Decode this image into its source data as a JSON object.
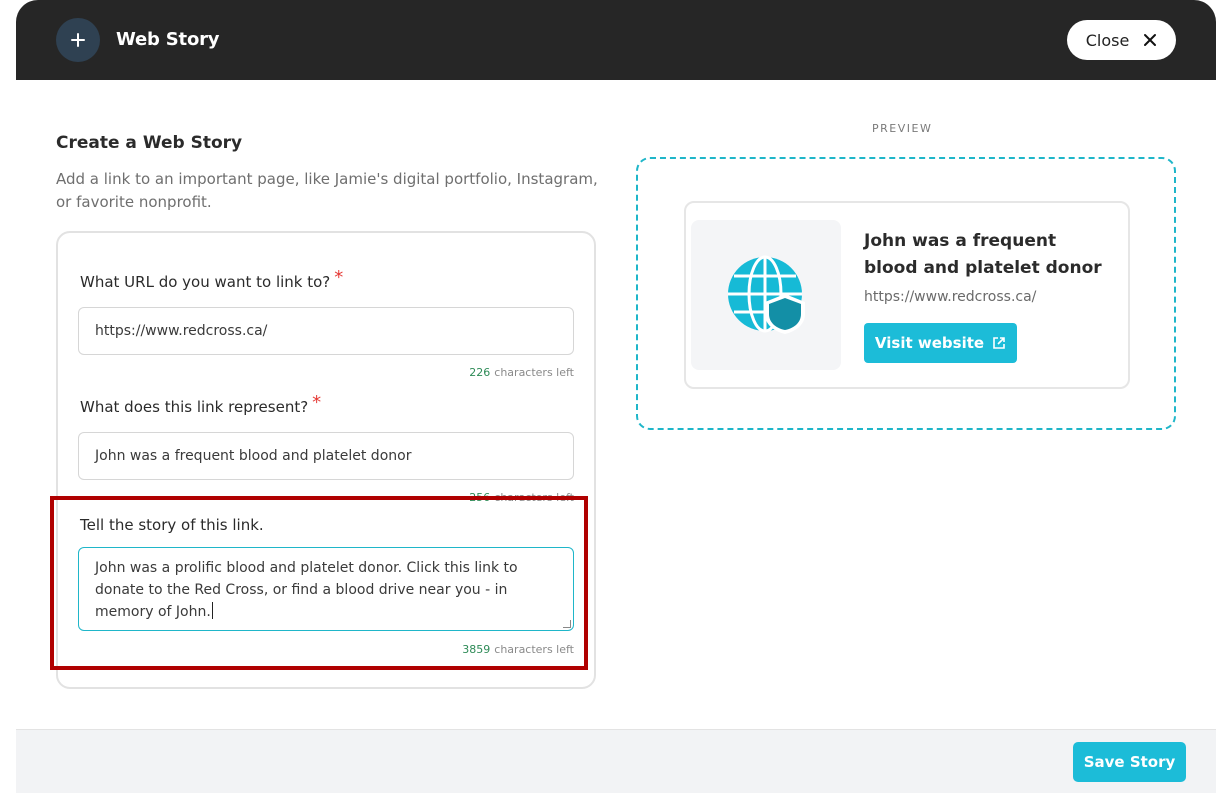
{
  "header": {
    "title": "Web Story",
    "close_label": "Close"
  },
  "form": {
    "heading": "Create a Web Story",
    "description": "Add a link to an important page, like Jamie's digital portfolio, Instagram, or favorite nonprofit.",
    "url_label": "What URL do you want to link to?",
    "url_value": "https://www.redcross.ca/",
    "url_counter": "226",
    "represent_label": "What does this link represent?",
    "represent_value": "John was a frequent blood and platelet donor",
    "represent_counter": "256",
    "story_label": "Tell the story of this link.",
    "story_value": "John was a prolific blood and platelet donor. Click this link to donate to the Red Cross, or find a blood drive near you - in memory of John.",
    "story_counter": "3859",
    "counter_suffix": "characters left",
    "required_mark": "*"
  },
  "preview": {
    "label": "PREVIEW",
    "title": "John was a frequent blood and platelet donor",
    "url": "https://www.redcross.ca/",
    "visit_label": "Visit website"
  },
  "footer": {
    "save_label": "Save Story"
  },
  "colors": {
    "accent": "#1cbcd8",
    "header_bg": "#262626",
    "required": "#e53935",
    "highlight": "#b00000"
  }
}
